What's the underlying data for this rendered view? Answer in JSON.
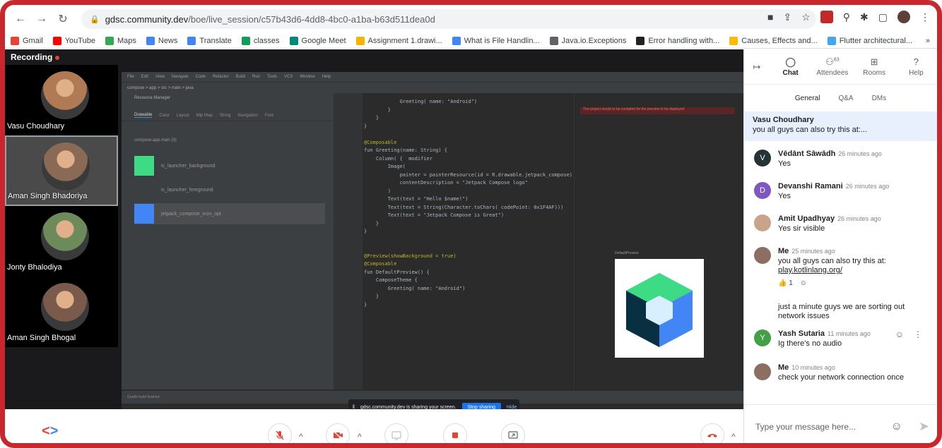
{
  "browser": {
    "url_host": "gdsc.community.dev",
    "url_path": "/boe/live_session/c57b43d6-4dd8-4bc0-a1ba-b63d511dea0d",
    "bookmarks": [
      {
        "label": "Gmail",
        "color": "#ea4335"
      },
      {
        "label": "YouTube",
        "color": "#ff0000"
      },
      {
        "label": "Maps",
        "color": "#34a853"
      },
      {
        "label": "News",
        "color": "#4285f4"
      },
      {
        "label": "Translate",
        "color": "#4285f4"
      },
      {
        "label": "classes",
        "color": "#0f9d58"
      },
      {
        "label": "Google Meet",
        "color": "#00897b"
      },
      {
        "label": "Assignment 1.drawi...",
        "color": "#f4b400"
      },
      {
        "label": "What is File Handlin...",
        "color": "#4285f4"
      },
      {
        "label": "Java.io.Exceptions",
        "color": "#5f6368"
      },
      {
        "label": "Error handling with...",
        "color": "#202124"
      },
      {
        "label": "Causes, Effects and...",
        "color": "#fbbc05"
      },
      {
        "label": "Flutter architectural...",
        "color": "#42a5f5"
      }
    ],
    "more": "»"
  },
  "stage": {
    "recording_label": "Recording",
    "participants": [
      {
        "name": "Vasu Choudhary",
        "active": false,
        "color": "#b07a55"
      },
      {
        "name": "Aman Singh Bhadoriya",
        "active": true,
        "color": "#8a6a55"
      },
      {
        "name": "Jonty Bhalodiya",
        "active": false,
        "color": "#6d8a5a"
      },
      {
        "name": "Aman Singh Bhogal",
        "active": false,
        "color": "#7a5a4a"
      }
    ],
    "share_banner": {
      "text": "gdsc.community.dev is sharing your screen.",
      "stop_label": "Stop sharing",
      "hide_label": "Hide"
    }
  },
  "ide": {
    "menu": [
      "File",
      "Edit",
      "View",
      "Navigate",
      "Code",
      "Refactor",
      "Build",
      "Run",
      "Tools",
      "VCS",
      "Window",
      "Help"
    ],
    "resource_manager_title": "Resource Manager",
    "resource_tabs": [
      "Drawable",
      "Color",
      "Layout",
      "Mip Map",
      "String",
      "Navigation",
      "Font"
    ],
    "module": "compose.app.main (3)",
    "resources": [
      {
        "name": "ic_launcher_background",
        "color": "#3ddc84"
      },
      {
        "name": "ic_launcher_foreground",
        "color": "#3c3f41"
      },
      {
        "name": "jetpack_compose_icon_opt",
        "color": "#4285f4"
      }
    ],
    "code": [
      "            Greeting( name: \"Android\")",
      "        }",
      "    }",
      "}",
      "",
      "@Composable",
      "fun Greeting(name: String) {",
      "    Column( {  modifier",
      "        Image(",
      "            painter = painterResource(id = R.drawable.jetpack_compose)",
      "            contentDescription = \"Jetpack Compose logo\"",
      "        )",
      "        Text(text = \"Hello $name!\")",
      "        Text(text = String(Character.toChars( codePoint: 0x1F4AF)))",
      "        Text(text = \"Jetpack Compose is Great\")",
      "    }",
      "}",
      "",
      "",
      "@Preview(showBackground = true)",
      "@Composable",
      "fun DefaultPreview() {",
      "    ComposeTheme {",
      "        Greeting( name: \"Android\")",
      "    }",
      "}"
    ],
    "preview_error": "The project needs to be compiled for the preview to be displayed",
    "preview_label": "DefaultPreview"
  },
  "controls": {
    "mic_icon": "mic-off-icon",
    "cam_icon": "videocam-off-icon",
    "captions_icon": "captions-icon",
    "record_icon": "stop-record-icon",
    "present_icon": "present-screen-icon",
    "leave_icon": "hang-up-icon"
  },
  "panel": {
    "tabs": [
      {
        "label": "Chat",
        "icon": "chat-icon",
        "active": true
      },
      {
        "label": "Attendees",
        "icon": "people-icon",
        "badge": "83",
        "active": false
      },
      {
        "label": "Rooms",
        "icon": "rooms-icon",
        "active": false
      },
      {
        "label": "Help",
        "icon": "help-icon",
        "active": false
      }
    ],
    "subtabs": [
      "General",
      "Q&A",
      "DMs"
    ],
    "pinned": {
      "name": "Vasu Choudhary",
      "text": "you all guys can also try this at:..."
    },
    "messages": [
      {
        "name": "Vēdānt Sāwādh",
        "time": "26 minutes ago",
        "text": "Yes",
        "avatar_letter": "V",
        "avatar_color": "#263238"
      },
      {
        "name": "Devanshi Ramani",
        "time": "26 minutes ago",
        "text": "Yes",
        "avatar_letter": "D",
        "avatar_color": "#7e57c2"
      },
      {
        "name": "Amit Upadhyay",
        "time": "26 minutes ago",
        "text": "Yes sir visible",
        "avatar_letter": "",
        "avatar_color": "#c9a38a"
      },
      {
        "name": "Me",
        "time": "25 minutes ago",
        "text": "you all guys can also try this at: ",
        "link": "play.kotlinlang.org/",
        "reaction": "👍 1",
        "avatar_letter": "",
        "avatar_color": "#8d6e63"
      },
      {
        "name": "",
        "time": "",
        "text": "just a minute guys we are sorting out network issues"
      },
      {
        "name": "Yash Sutaria",
        "time": "11 minutes ago",
        "text": "Ig there's no audio",
        "avatar_letter": "Y",
        "avatar_color": "#43a047"
      },
      {
        "name": "Me",
        "time": "10 minutes ago",
        "text": "check your network connection once",
        "avatar_letter": "",
        "avatar_color": "#8d6e63"
      }
    ],
    "input_placeholder": "Type your message here..."
  }
}
